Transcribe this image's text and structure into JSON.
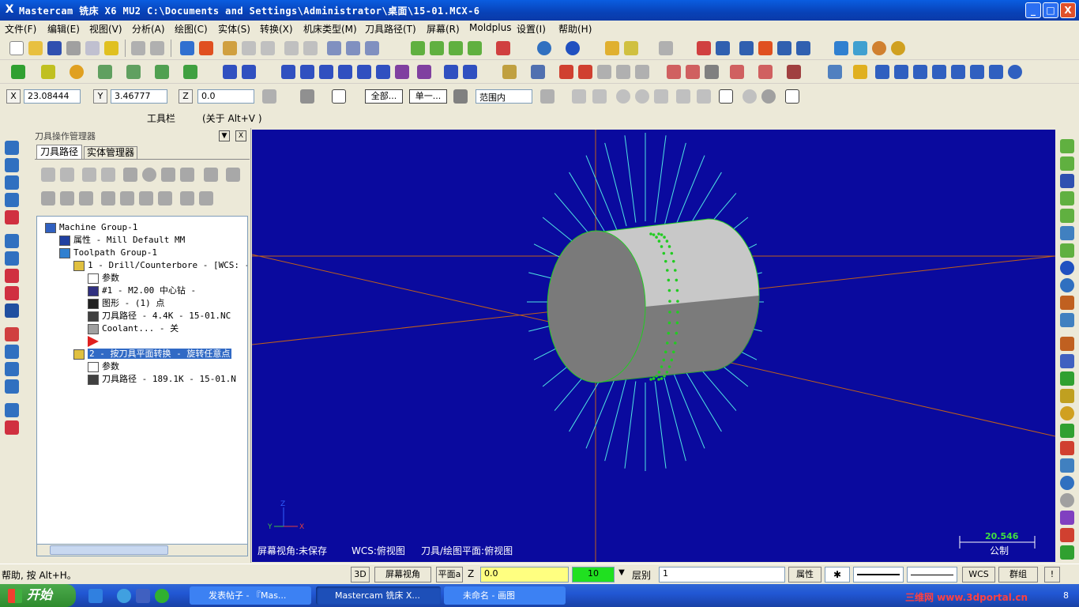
{
  "window": {
    "title": "Mastercam 铣床 X6 MU2  C:\\Documents and Settings\\Administrator\\桌面\\15-01.MCX-6",
    "icon": "X",
    "min": "_",
    "max": "□",
    "close": "X"
  },
  "menu": [
    "文件(F)",
    "编辑(E)",
    "视图(V)",
    "分析(A)",
    "绘图(C)",
    "实体(S)",
    "转换(X)",
    "机床类型(M)",
    "刀具路径(T)",
    "屏幕(R)",
    "Moldplus",
    "设置(I)",
    "帮助(H)"
  ],
  "coords": {
    "x_label": "X",
    "x_value": "23.08444",
    "y_label": "Y",
    "y_value": "3.46777",
    "z_label": "Z",
    "z_value": "0.0",
    "all_btn": "全部...",
    "single_btn": "单一...",
    "range_select": "范围内"
  },
  "toolbar_info": {
    "label": "工具栏",
    "hint": "(关于 Alt+V )"
  },
  "panel": {
    "title": "刀具操作管理器",
    "close": "X",
    "tabs": [
      "刀具路径",
      "实体管理器"
    ],
    "tree": [
      {
        "text": "Machine Group-1",
        "indent": 0
      },
      {
        "text": "属性 - Mill Default MM",
        "indent": 1
      },
      {
        "text": "Toolpath Group-1",
        "indent": 1
      },
      {
        "text": "1 - Drill/Counterbore - [WCS: -",
        "indent": 2
      },
      {
        "text": "参数",
        "indent": 3
      },
      {
        "text": "#1 - M2.00 中心钻 -",
        "indent": 3
      },
      {
        "text": "图形 - (1) 点",
        "indent": 3
      },
      {
        "text": "刀具路径 - 4.4K - 15-01.NC",
        "indent": 3
      },
      {
        "text": "Coolant... - 关",
        "indent": 3
      },
      {
        "text": "",
        "indent": 3
      },
      {
        "text": "2 - 按刀具平面转换 - 旋转任意点",
        "indent": 2
      },
      {
        "text": "参数",
        "indent": 3
      },
      {
        "text": "刀具路径 - 189.1K - 15-01.N",
        "indent": 3
      }
    ]
  },
  "viewport": {
    "view_label": "屏幕视角:未保存",
    "wcs_label": "WCS:俯视图",
    "plane_label": "刀具/绘图平面:俯视图",
    "scale_value": "20.546",
    "scale_unit": "公制",
    "axis_z": "Z",
    "axis_y": "Y",
    "axis_x": "X"
  },
  "status": {
    "help": "帮助, 按 Alt+H。",
    "btn_3d": "3D",
    "screen_view": "屏幕视角",
    "plane": "平面a",
    "z_label": "Z",
    "z_value": "0.0",
    "level_value": "10",
    "level_label": "层别",
    "level_field": "1",
    "attr": "属性",
    "wcs": "WCS",
    "group": "群组",
    "excl": "!"
  },
  "taskbar": {
    "start": "开始",
    "tasks": [
      "发表帖子 - 『Mas...",
      "Mastercam 铣床 X...",
      "未命名 - 画图"
    ],
    "watermark": "三维网 www.3dportal.cn",
    "clock": "8"
  },
  "colors": {
    "title": "#0842b8",
    "viewport": "#0a0a9e",
    "cyl_face": "#7a7a7a",
    "cyl_body": "#c8c8c8",
    "ray": "#4fe3e3",
    "hole": "#22cc22",
    "axis": "#c0601a",
    "highlight": "#316ac5"
  }
}
